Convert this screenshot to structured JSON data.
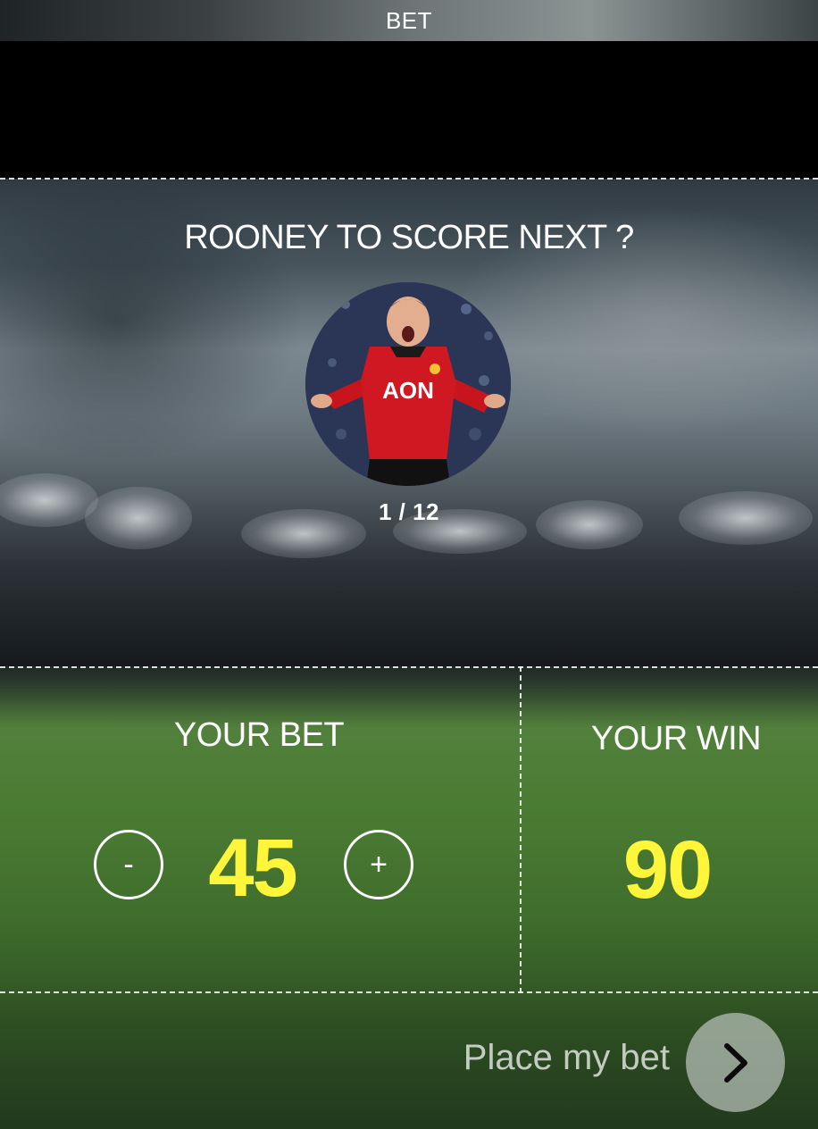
{
  "header": {
    "title": "BET"
  },
  "bet": {
    "question": "ROONEY TO SCORE NEXT ?",
    "counter": "1 / 12",
    "player_image": "rooney-celebrating-photo"
  },
  "your_bet": {
    "label": "YOUR BET",
    "value": "45",
    "decrement_label": "-",
    "increment_label": "+"
  },
  "your_win": {
    "label": "YOUR WIN",
    "value": "90"
  },
  "footer": {
    "place_bet_label": "Place my bet",
    "next_icon": "chevron-right-icon"
  },
  "colors": {
    "accent_yellow": "#fff53a",
    "text_white": "#ffffff"
  }
}
